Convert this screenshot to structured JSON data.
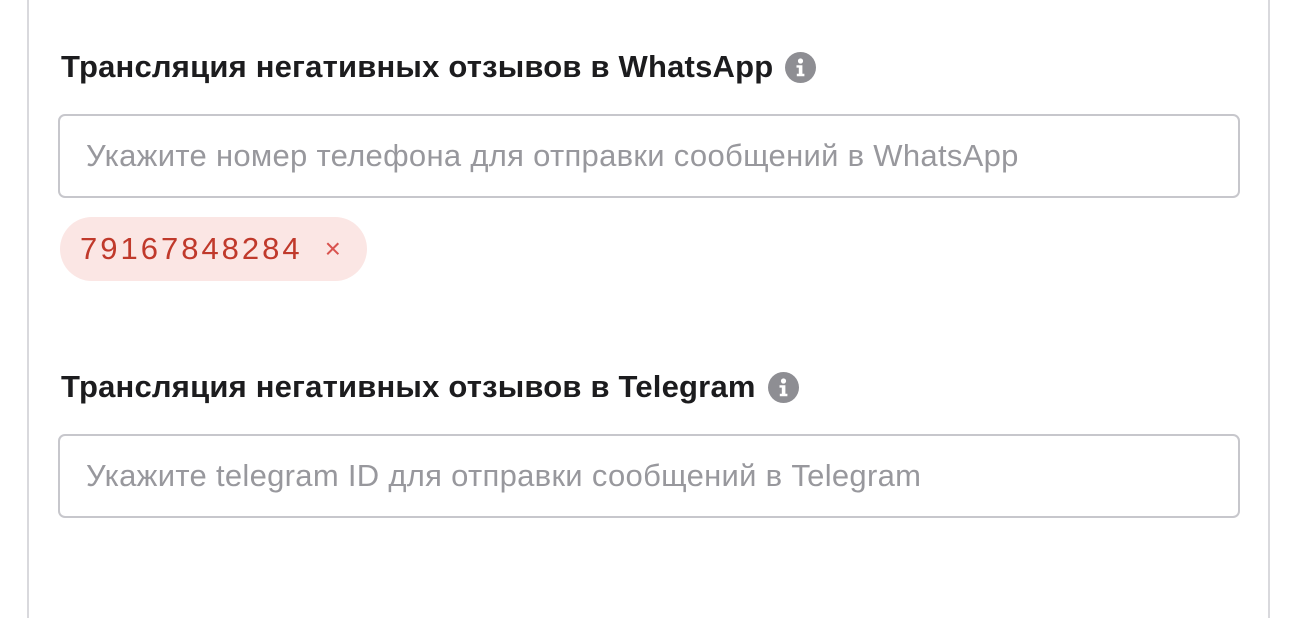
{
  "whatsapp": {
    "label": "Трансляция негативных отзывов в WhatsApp",
    "info_icon": "info-circle-icon",
    "input_placeholder": "Укажите номер телефона для отправки сообщений в WhatsApp",
    "input_value": "",
    "tags": [
      {
        "value": "79167848284",
        "remove_symbol": "×"
      }
    ]
  },
  "telegram": {
    "label": "Трансляция негативных отзывов в Telegram",
    "info_icon": "info-circle-icon",
    "input_placeholder": "Укажите telegram ID для отправки сообщений в Telegram",
    "input_value": ""
  },
  "colors": {
    "label_text": "#1c1c1e",
    "placeholder": "#98989d",
    "input_border": "#c7c7cc",
    "info_icon_bg": "#8e8e93",
    "tag_bg": "#fbe6e4",
    "tag_text": "#c0392b",
    "tag_remove": "#d9534f"
  }
}
